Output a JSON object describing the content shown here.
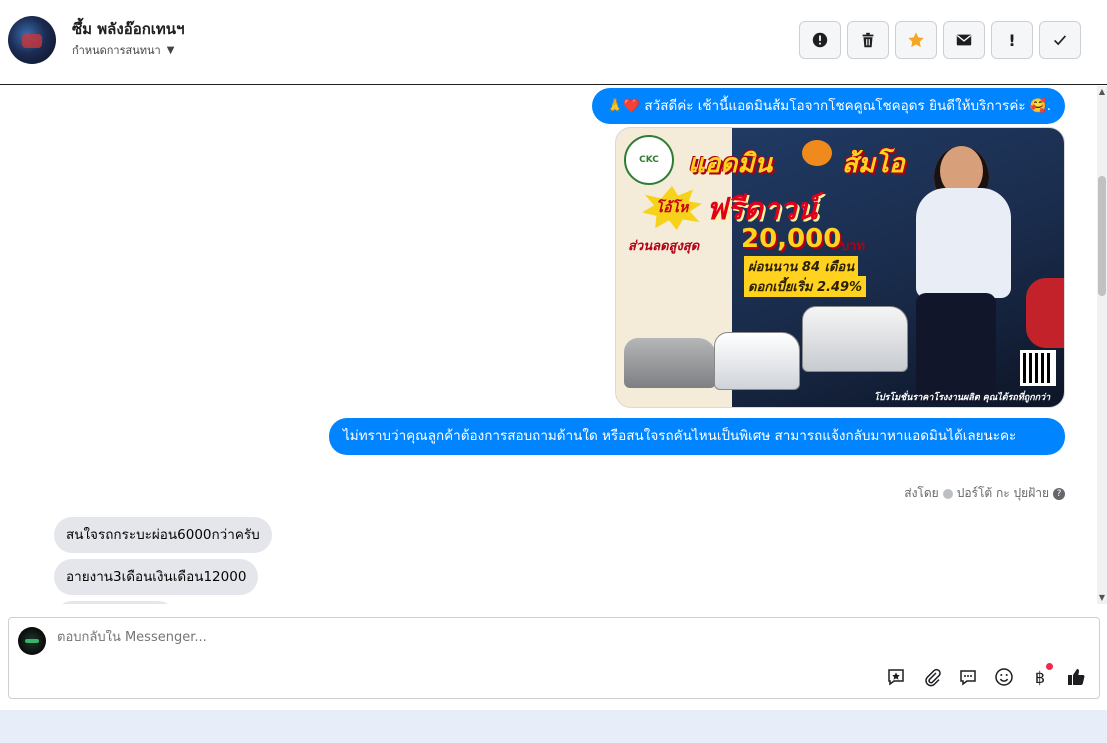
{
  "header": {
    "contact_name": "ซึ้ม พลังอ๊อกเทนฯ",
    "assign_label": "กำหนดการสนทนา",
    "actions": [
      {
        "icon": "alert-icon",
        "label": "!"
      },
      {
        "icon": "trash-icon",
        "label": "trash"
      },
      {
        "icon": "star-icon",
        "label": "★"
      },
      {
        "icon": "mail-icon",
        "label": "mail"
      },
      {
        "icon": "exclamation-icon",
        "label": "!"
      },
      {
        "icon": "check-icon",
        "label": "✓"
      }
    ]
  },
  "thread": {
    "outgoing_1": "🙏❤️ สวัสดีค่ะ เช้านี้แอดมินส้มโอจากโชคคูณโชคอุดร ยินดีให้บริการค่ะ 🥰.",
    "promo": {
      "logo_text": "CKC",
      "title_a": "แอดมิน",
      "title_b": "ส้มโอ",
      "burst": "โอ้โห",
      "free": "ฟรีดาวน์",
      "discount": "ส่วนลดสูงสุด",
      "amount": "20,000",
      "baht": "บาท",
      "installment": "ผ่อนนาน 84 เดือน",
      "interest": "ดอกเบี้ยเริ่ม 2.49%",
      "footer": "โปรโมชั่นราคาโรงงานผลิต คุณได้รถที่ถูกกว่า"
    },
    "outgoing_2": "ไม่ทราบว่าคุณลูกค้าต้องการสอบถามด้านใด หรือสนใจรถคันไหนเป็นพิเศษ สามารถแจ้งกลับมาหาแอดมินได้เลยนะคะ",
    "sent_by_prefix": "ส่งโดย",
    "sent_by_name": "ปอร์โต้ กะ ปุยฝ้าย",
    "incoming": [
      "สนใจรถกระบะผ่อน6000กว่าครับ",
      "อายงาน3เดือนเงินเดือน12000"
    ]
  },
  "composer": {
    "placeholder": "ตอบกลับใน Messenger...",
    "baht_symbol": "฿"
  },
  "colors": {
    "outgoing_bubble": "#0084ff",
    "incoming_bubble": "#e4e6eb",
    "star": "#f5a623"
  }
}
